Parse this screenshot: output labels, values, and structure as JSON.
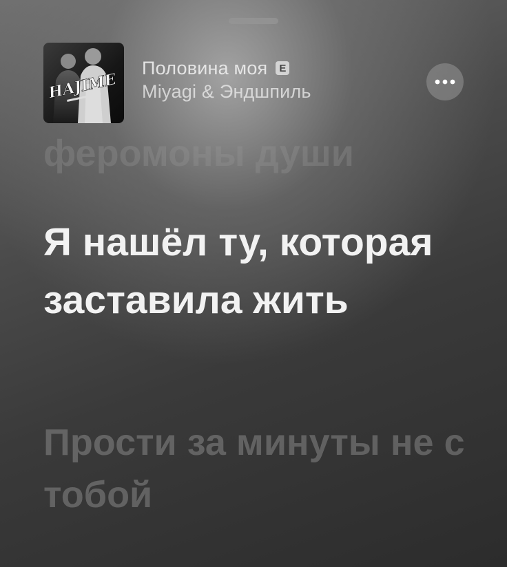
{
  "track": {
    "title": "Половина моя",
    "explicit_badge": "E",
    "artist": "Miyagi & Эндшпиль",
    "cover_text": "HAJIME"
  },
  "lyrics": {
    "previous": "феромоны души",
    "current": "Я нашёл ту, которая заставила жить",
    "next": "Прости за минуты не с тобой"
  },
  "icons": {
    "more": "more-horizontal-icon",
    "grabber": "drag-handle"
  }
}
